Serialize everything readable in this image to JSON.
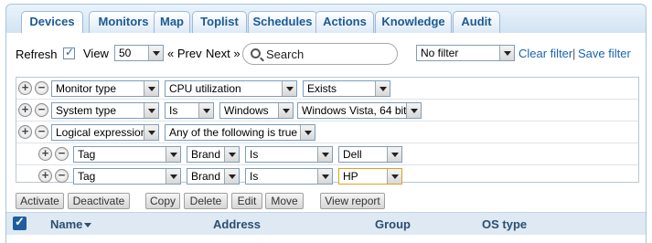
{
  "tabs": [
    {
      "label": "Devices",
      "active": true
    },
    {
      "label": "Monitors"
    },
    {
      "label": "Map"
    },
    {
      "label": "Toplist"
    },
    {
      "label": "Schedules"
    },
    {
      "label": "Actions"
    },
    {
      "label": "Knowledge"
    },
    {
      "label": "Audit"
    }
  ],
  "toolbar": {
    "refresh_label": "Refresh",
    "refresh_checked": true,
    "view_label": "View",
    "view_value": "50",
    "prev_label": "« Prev",
    "next_label": "Next »",
    "search_placeholder": "Search",
    "filter_value": "No filter",
    "clear_filter": "Clear filter",
    "separator": "|",
    "save_filter": "Save filter"
  },
  "filter_rows": [
    {
      "field": "Monitor type",
      "operator": "CPU utilization",
      "value": "Exists"
    },
    {
      "field": "System type",
      "operator": "Is",
      "value": "Windows",
      "extra": "Windows Vista, 64 bit"
    },
    {
      "field": "Logical expression",
      "operator": "Any of the following is true"
    },
    {
      "field": "Tag",
      "sub": "Brand",
      "operator": "Is",
      "value": "Dell"
    },
    {
      "field": "Tag",
      "sub": "Brand",
      "operator": "Is",
      "value": "HP"
    }
  ],
  "actions": {
    "activate": "Activate",
    "deactivate": "Deactivate",
    "copy": "Copy",
    "delete": "Delete",
    "edit": "Edit",
    "move": "Move",
    "view_report": "View report"
  },
  "table": {
    "columns": [
      "Name",
      "Address",
      "Group",
      "OS type"
    ],
    "select_all_checked": true,
    "sort_column": "Name"
  },
  "colors": {
    "tab_text": "#1b5a95",
    "link": "#1b63b0",
    "header_bg": "#dfe9f3"
  },
  "icons": {
    "add": "plus-circle-icon",
    "remove": "minus-circle-icon",
    "search": "magnifier-icon",
    "dropdown": "chevron-down-icon"
  }
}
